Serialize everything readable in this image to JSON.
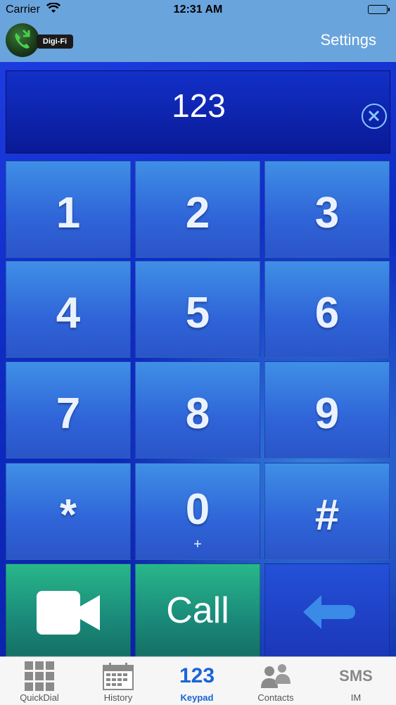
{
  "status_bar": {
    "carrier": "Carrier",
    "time": "12:31 AM"
  },
  "nav": {
    "logo_text": "Digi-Fi",
    "settings_label": "Settings"
  },
  "display": {
    "number": "123"
  },
  "keypad": {
    "keys": [
      {
        "digit": "1",
        "sub": ""
      },
      {
        "digit": "2",
        "sub": ""
      },
      {
        "digit": "3",
        "sub": ""
      },
      {
        "digit": "4",
        "sub": ""
      },
      {
        "digit": "5",
        "sub": ""
      },
      {
        "digit": "6",
        "sub": ""
      },
      {
        "digit": "7",
        "sub": ""
      },
      {
        "digit": "8",
        "sub": ""
      },
      {
        "digit": "9",
        "sub": ""
      },
      {
        "digit": "*",
        "sub": ""
      },
      {
        "digit": "0",
        "sub": "+"
      },
      {
        "digit": "#",
        "sub": ""
      }
    ],
    "call_label": "Call"
  },
  "tabs": [
    {
      "label": "QuickDial",
      "icon": "grid-icon",
      "active": false
    },
    {
      "label": "History",
      "icon": "calendar-icon",
      "active": false
    },
    {
      "label": "Keypad",
      "icon_text": "123",
      "active": true
    },
    {
      "label": "Contacts",
      "icon": "contacts-icon",
      "active": false
    },
    {
      "label": "IM",
      "icon_text": "SMS",
      "active": false
    }
  ],
  "colors": {
    "navbar": "#6aa4dc",
    "key_blue": "#3f8fe6",
    "call_green": "#28b78a",
    "tab_active": "#1a64d8"
  }
}
